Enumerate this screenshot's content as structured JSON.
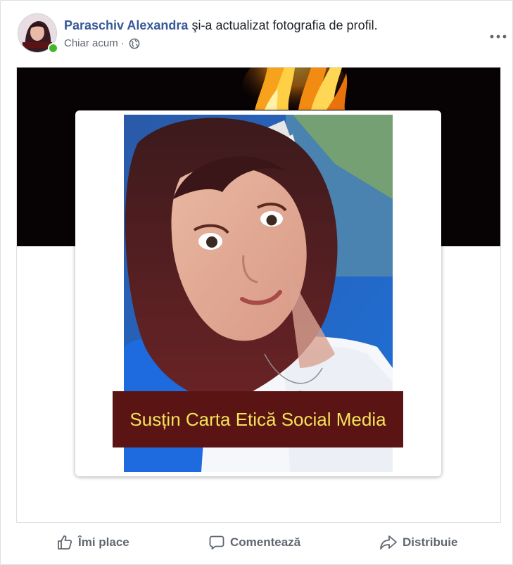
{
  "post": {
    "author": "Paraschiv Alexandra",
    "action_text": " şi-a actualizat fotografia de profil.",
    "time": "Chiar acum",
    "separator": "·",
    "privacy_icon": "globe-icon",
    "more_icon": "more-options-icon"
  },
  "photo": {
    "frame_caption": "Susțin Carta Etică Social Media"
  },
  "actions": {
    "like_label": "Îmi place",
    "comment_label": "Comentează",
    "share_label": "Distribuie"
  },
  "colors": {
    "author_link": "#385898",
    "online_status": "#42b72a",
    "banner_bg": "#5a1414",
    "banner_text": "#f2e35a"
  }
}
